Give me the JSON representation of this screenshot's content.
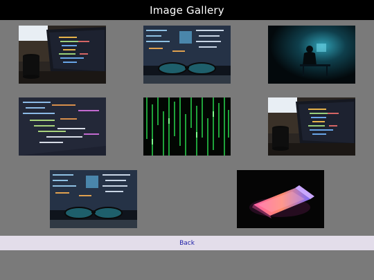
{
  "header": {
    "title": "Image Gallery"
  },
  "gallery": {
    "images": [
      {
        "icon": "laptop-coffee-code-photo"
      },
      {
        "icon": "glasses-monitor-code-photo"
      },
      {
        "icon": "hacker-dark-room-photo"
      },
      {
        "icon": "code-screen-closeup-photo"
      },
      {
        "icon": "matrix-green-code-photo"
      },
      {
        "icon": "laptop-coffee-code-photo"
      },
      {
        "icon": "glasses-monitor-code-photo"
      },
      {
        "icon": "laptop-neon-glow-photo"
      }
    ]
  },
  "footer": {
    "back_label": "Back"
  },
  "colors": {
    "header_bg": "#000000",
    "page_bg": "#7a7a7a",
    "back_bar_bg": "#e3ddea",
    "back_text": "#1a1aa6"
  }
}
